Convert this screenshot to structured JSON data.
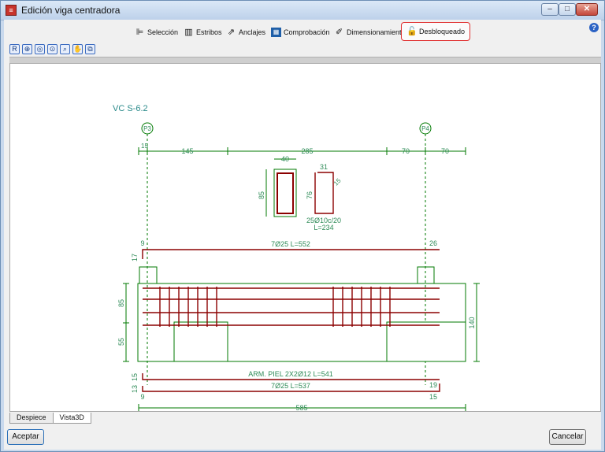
{
  "window": {
    "title": "Edición viga centradora"
  },
  "toolbar": {
    "items": [
      {
        "label": "Selección",
        "icon": "selection-icon"
      },
      {
        "label": "Estribos",
        "icon": "stirrups-icon"
      },
      {
        "label": "Anclajes",
        "icon": "anchorage-icon"
      },
      {
        "label": "Comprobación",
        "icon": "check-icon"
      },
      {
        "label": "Dimensionamiento",
        "icon": "sizing-icon"
      },
      {
        "label": "Desbloqueado",
        "icon": "unlocked-padlock-icon"
      }
    ],
    "active": "Desbloqueado",
    "accent": "#e03030"
  },
  "drawing": {
    "beam_name": "VC S-6.2",
    "pillar_left": "P3",
    "pillar_right": "P4",
    "top_dims": [
      "15",
      "145",
      "285",
      "70",
      "70"
    ],
    "stirrup_width": "40",
    "stirrup_height": "85",
    "stirrup2_top": "31",
    "stirrup2_height": "76",
    "stirrup2_hook": "15",
    "stirrups_spec": "25Ø10c/20",
    "stirrups_length": "L=234",
    "top_bar_left_hook": "9",
    "top_bar_left_vert": "17",
    "top_bar_label": "7Ø25 L=552",
    "top_bar_right_hook": "26",
    "left_dim_upper": "85",
    "left_dim_lower": "55",
    "right_dim": "140",
    "skin_label": "ARM. PIEL 2X2Ø12 L=541",
    "skin_left_vert": "15",
    "bottom_bar_label": "7Ø25 L=537",
    "bottom_left_vert": "13",
    "bottom_left_hook": "9",
    "bottom_right_hook": "19",
    "bottom_right_hook2": "15",
    "total_dim": "585",
    "colors": {
      "dimension": "#007a00",
      "rebar": "#8b0000",
      "text": "#2e8b57"
    }
  },
  "tabs": [
    {
      "label": "Despiece"
    },
    {
      "label": "Vista3D"
    }
  ],
  "buttons": {
    "accept": "Aceptar",
    "cancel": "Cancelar"
  }
}
